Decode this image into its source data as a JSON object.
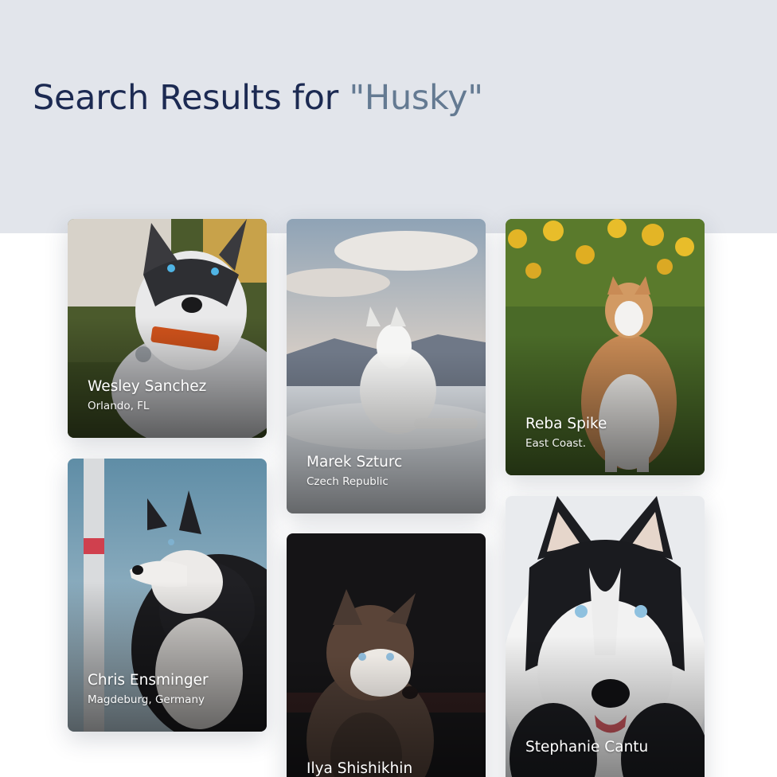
{
  "header": {
    "title_prefix": "Search Results for ",
    "query": "\"Husky\""
  },
  "results": [
    {
      "name": "Wesley Sanchez",
      "location": "Orlando, FL",
      "image": "husky-puppy-with-collar-photo"
    },
    {
      "name": "Marek Szturc",
      "location": "Czech Republic",
      "image": "white-husky-on-snowy-mountain-photo"
    },
    {
      "name": "Reba Spike",
      "location": "East Coast.",
      "image": "husky-in-sunflower-field-photo"
    },
    {
      "name": "Chris Ensminger",
      "location": "Magdeburg, Germany",
      "image": "husky-side-profile-sky-photo"
    },
    {
      "name": "Ilya Shishikhin",
      "location": "",
      "image": "brown-husky-dark-background-photo"
    },
    {
      "name": "Stephanie Cantu",
      "location": "",
      "image": "husky-face-closeup-snow-photo"
    }
  ],
  "colors": {
    "header_background": "#e2e5eb",
    "title_text": "#1c2a52",
    "query_text": "#647a92",
    "page_background": "#ffffff"
  }
}
